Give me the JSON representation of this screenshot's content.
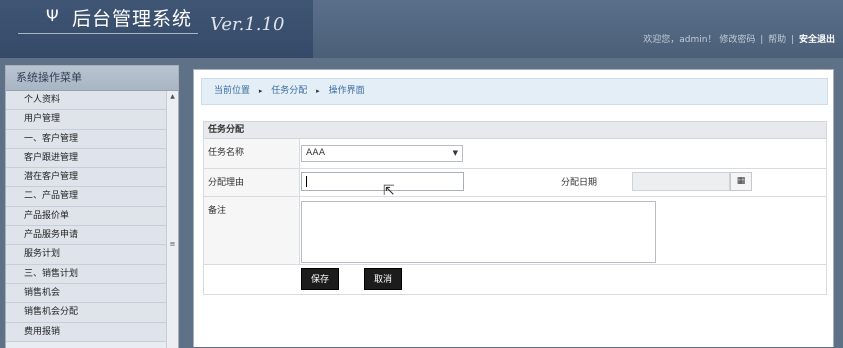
{
  "header": {
    "logo_mark": "Ψ",
    "title": "后台管理系统",
    "version": "Ver.1.10",
    "welcome": "欢迎您，admin！",
    "links": {
      "change_password": "修改密码",
      "help": "帮助",
      "logout": "安全退出",
      "separator": "|"
    }
  },
  "sidebar": {
    "title": "系统操作菜单",
    "items": [
      "个人资料",
      "用户管理",
      "一、客户管理",
      "客户跟进管理",
      "潜在客户管理",
      "二、产品管理",
      "产品报价单",
      "产品服务申请",
      "服务计划",
      "三、销售计划",
      "销售机会",
      "销售机会分配",
      "费用报销"
    ]
  },
  "breadcrumb": {
    "items": [
      "当前位置",
      "任务分配",
      "操作界面"
    ],
    "arrow": "▸"
  },
  "form": {
    "heading": "任务分配",
    "task_name_label": "任务名称",
    "task_name_value": "AAA",
    "reason_label": "分配理由",
    "reason_value": "",
    "date_label": "分配日期",
    "date_value": "",
    "note_label": "备注",
    "save_label": "保存",
    "cancel_label": "取消"
  },
  "colors": {
    "header_bg": "#4b5f78",
    "breadcrumb_text": "#3d6d9f",
    "button_bg": "#1c1c1c"
  }
}
